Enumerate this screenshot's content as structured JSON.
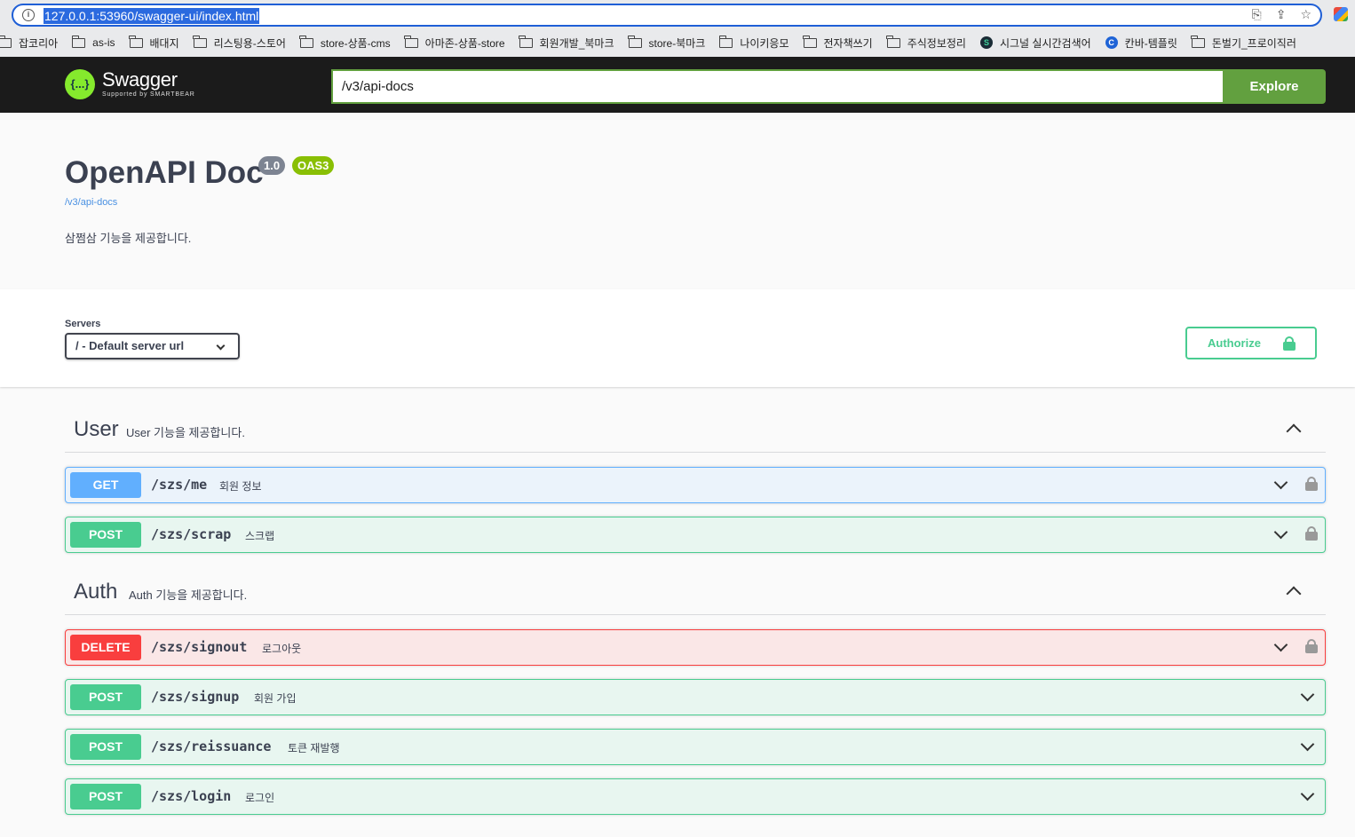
{
  "browser": {
    "url": "127.0.0.1:53960/swagger-ui/index.html",
    "bookmarks": [
      {
        "label": "잡코리아",
        "icon": "folder-icon"
      },
      {
        "label": "as-is",
        "icon": "folder-icon"
      },
      {
        "label": "배대지",
        "icon": "folder-icon"
      },
      {
        "label": "리스팅용-스토어",
        "icon": "folder-icon"
      },
      {
        "label": "store-상품-cms",
        "icon": "folder-icon"
      },
      {
        "label": "아마존-상품-store",
        "icon": "folder-icon"
      },
      {
        "label": "회원개발_북마크",
        "icon": "folder-icon"
      },
      {
        "label": "store-북마크",
        "icon": "folder-icon"
      },
      {
        "label": "나이키응모",
        "icon": "folder-icon"
      },
      {
        "label": "전자책쓰기",
        "icon": "folder-icon"
      },
      {
        "label": "주식정보정리",
        "icon": "folder-icon"
      },
      {
        "label": "시그널 실시간검색어",
        "icon": "signal-icon"
      },
      {
        "label": "칸바-템플릿",
        "icon": "canva-icon"
      },
      {
        "label": "돈벌기_프로이직러",
        "icon": "folder-icon"
      }
    ]
  },
  "topbar": {
    "logo_text": "Swagger",
    "logo_sub": "Supported by SMARTBEAR",
    "logo_glyph": "{...}",
    "api_url": "/v3/api-docs",
    "explore_label": "Explore"
  },
  "info": {
    "title": "OpenAPI Doc",
    "version": "1.0",
    "oas": "OAS3",
    "link": "/v3/api-docs",
    "description": "삼쩜삼 기능을 제공합니다."
  },
  "servers": {
    "label": "Servers",
    "selected": "/ - Default server url"
  },
  "authorize_label": "Authorize",
  "tags": [
    {
      "name": "User",
      "description": "User 기능을 제공합니다.",
      "operations": [
        {
          "method": "GET",
          "path": "/szs/me",
          "summary": "회원 정보",
          "locked": true
        },
        {
          "method": "POST",
          "path": "/szs/scrap",
          "summary": "스크랩",
          "locked": true
        }
      ]
    },
    {
      "name": "Auth",
      "description": "Auth 기능을 제공합니다.",
      "operations": [
        {
          "method": "DELETE",
          "path": "/szs/signout",
          "summary": "로그아웃",
          "locked": true
        },
        {
          "method": "POST",
          "path": "/szs/signup",
          "summary": "회원 가입",
          "locked": false
        },
        {
          "method": "POST",
          "path": "/szs/reissuance",
          "summary": "토큰 재발행",
          "locked": false
        },
        {
          "method": "POST",
          "path": "/szs/login",
          "summary": "로그인",
          "locked": false
        }
      ]
    }
  ],
  "colors": {
    "get": "#61affe",
    "post": "#49cc90",
    "delete": "#f93e3e",
    "swagger_green": "#85ea2d",
    "explore_green": "#62a03f"
  }
}
